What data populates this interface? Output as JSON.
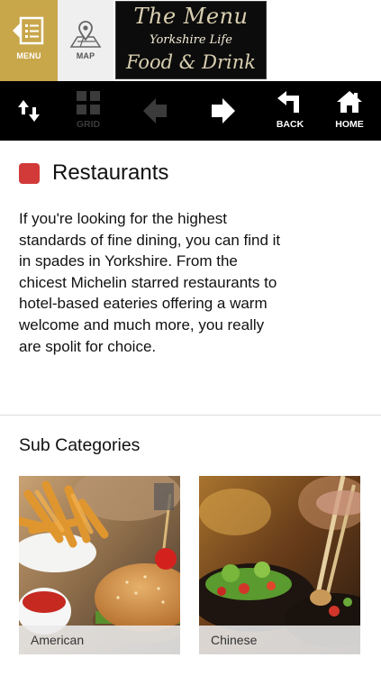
{
  "topbar": {
    "menu_tab": {
      "label": "MENU",
      "icon": "menu-list-icon"
    },
    "map_tab": {
      "label": "MAP",
      "icon": "map-pin-icon"
    },
    "logo": {
      "line1": "The Menu",
      "line2": "Yorkshire Life",
      "line3": "Food & Drink"
    }
  },
  "toolbar": {
    "items": [
      {
        "name": "sort",
        "label": "",
        "icon": "sort-arrows-icon",
        "enabled": true
      },
      {
        "name": "grid",
        "label": "GRID",
        "icon": "grid-icon",
        "enabled": false
      },
      {
        "name": "previous",
        "label": "",
        "icon": "arrow-left-icon",
        "enabled": false
      },
      {
        "name": "next",
        "label": "",
        "icon": "arrow-right-icon",
        "enabled": true
      },
      {
        "name": "back",
        "label": "BACK",
        "icon": "back-arrow-icon",
        "enabled": true
      },
      {
        "name": "home",
        "label": "HOME",
        "icon": "home-icon",
        "enabled": true
      }
    ]
  },
  "section": {
    "title": "Restaurants",
    "accent_color": "#d23a3a",
    "description": "If you're looking for the highest standards of fine dining, you can find it in spades in Yorkshire. From the chicest Michelin starred restaurants to hotel-based eateries offering a warm welcome and much more, you really are spolit for choice."
  },
  "subcategories": {
    "title": "Sub Categories",
    "items": [
      {
        "label": "American",
        "image": "burger-and-fries-photo"
      },
      {
        "label": "Chinese",
        "image": "chopsticks-dish-photo"
      }
    ]
  },
  "colors": {
    "gold": "#c8a64a",
    "toolbar": "#000000"
  }
}
